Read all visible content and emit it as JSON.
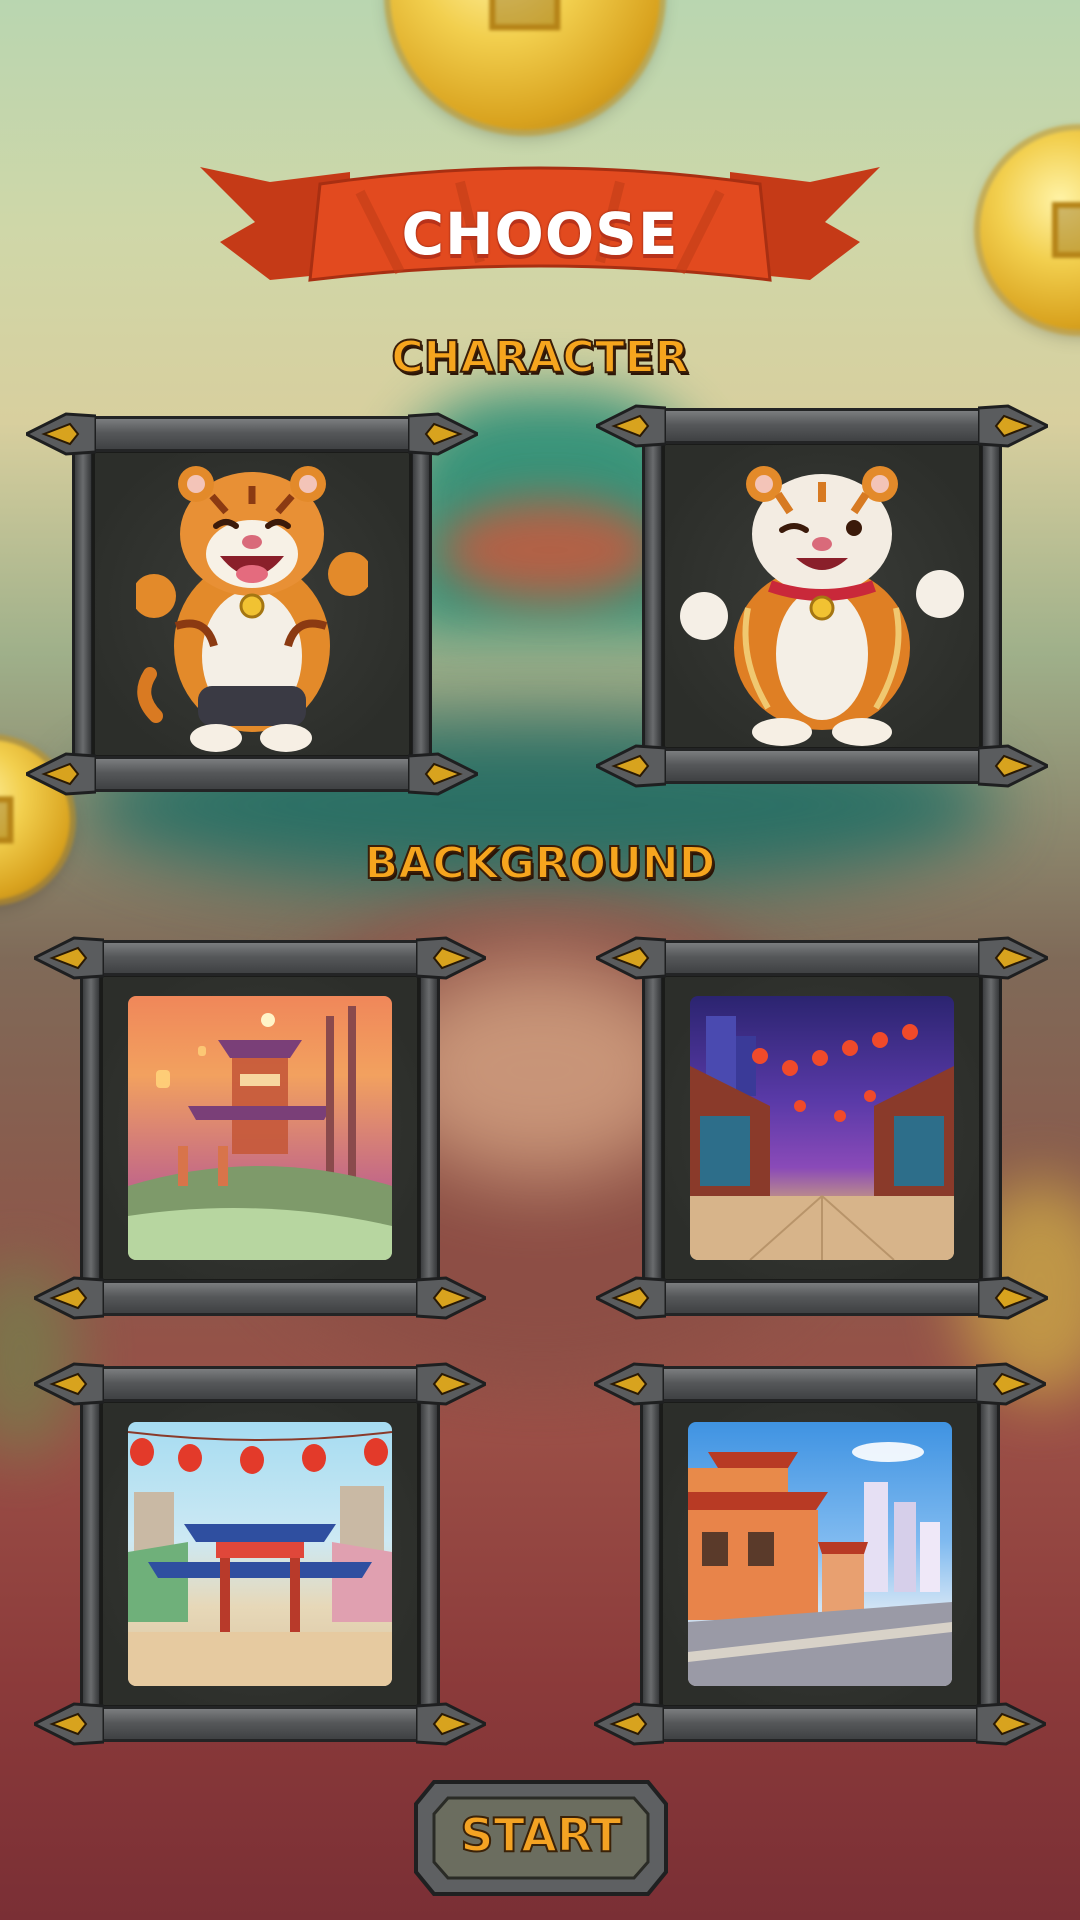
{
  "header": {
    "title": "CHOOSE"
  },
  "sections": {
    "character_label": "CHARACTER",
    "background_label": "BACKGROUND"
  },
  "characters": [
    {
      "icon": "tiger-character-icon",
      "pose": "cheering"
    },
    {
      "icon": "tiger-character-icon",
      "pose": "winking"
    }
  ],
  "backgrounds": [
    {
      "icon": "sunset-gate-scene",
      "palette": [
        "#f18a4e",
        "#b24f7b"
      ]
    },
    {
      "icon": "night-lantern-street-scene",
      "palette": [
        "#3b2a8a",
        "#8b3bb0"
      ]
    },
    {
      "icon": "day-gate-lantern-scene",
      "palette": [
        "#9ad7f0",
        "#e6d3a8"
      ]
    },
    {
      "icon": "pagoda-city-street-scene",
      "palette": [
        "#4ba3e8",
        "#e88a4a"
      ]
    }
  ],
  "actions": {
    "start_label": "START"
  },
  "colors": {
    "banner": "#e0461d",
    "label_fill": "#f6a51e",
    "frame_metal": "#56585a",
    "frame_panel": "#2f312d"
  }
}
